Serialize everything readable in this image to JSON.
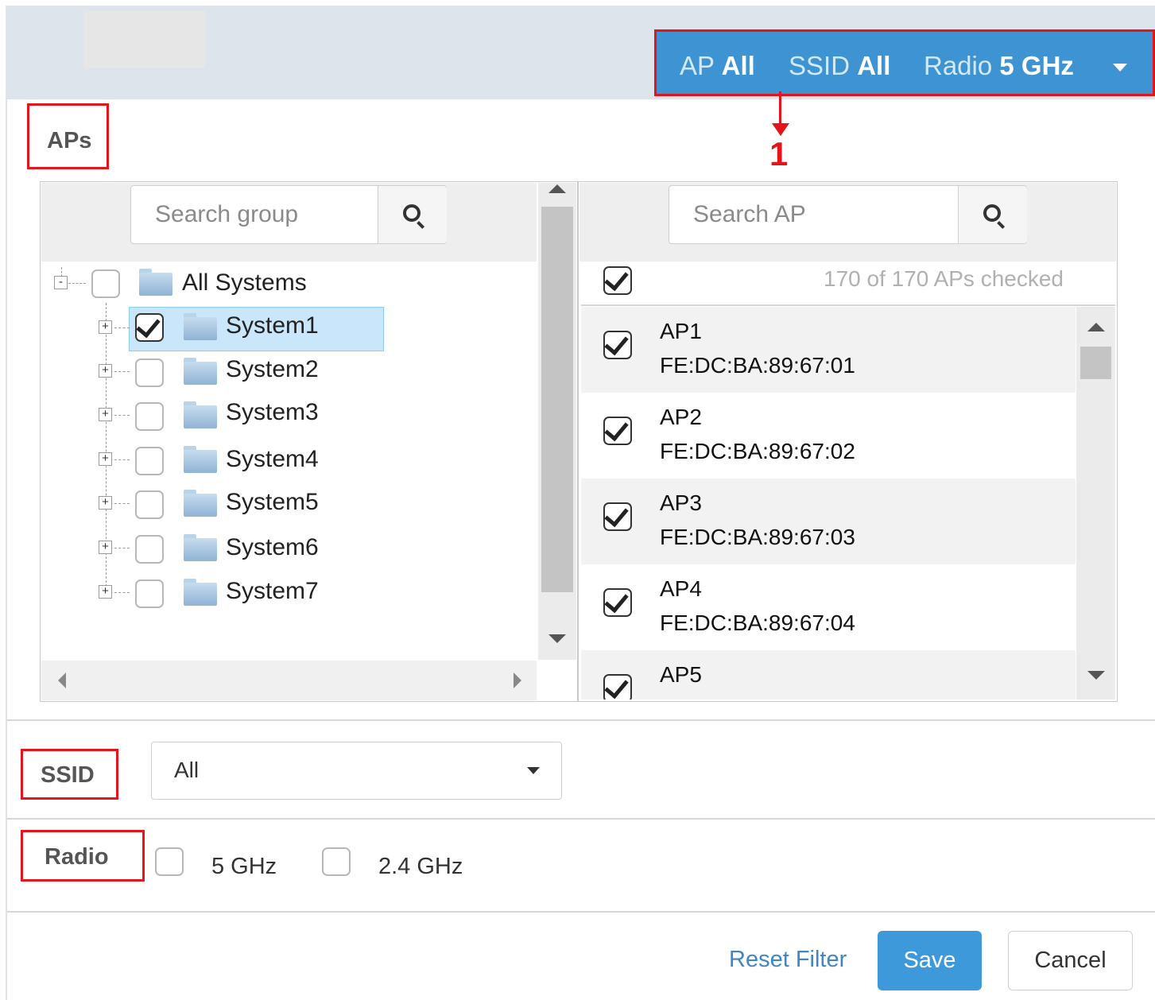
{
  "header": {
    "filter": {
      "ap_label": "AP",
      "ap_value": "All",
      "ssid_label": "SSID",
      "ssid_value": "All",
      "radio_label": "Radio",
      "radio_value": "5 GHz"
    },
    "callout_number": "1"
  },
  "aps_section": {
    "label": "APs",
    "group_search": {
      "placeholder": "Search group",
      "value": ""
    },
    "tree": {
      "root": {
        "label": "All Systems",
        "checked": false,
        "expanded": true
      },
      "children": [
        {
          "label": "System1",
          "checked": true,
          "selected": true
        },
        {
          "label": "System2",
          "checked": false
        },
        {
          "label": "System3",
          "checked": false
        },
        {
          "label": "System4",
          "checked": false
        },
        {
          "label": "System5",
          "checked": false
        },
        {
          "label": "System6",
          "checked": false
        },
        {
          "label": "System7",
          "checked": false
        }
      ]
    },
    "ap_search": {
      "placeholder": "Search AP",
      "value": ""
    },
    "select_all_checked": true,
    "checked_summary": "170 of 170 APs checked",
    "ap_list": [
      {
        "name": "AP1",
        "mac": "FE:DC:BA:89:67:01",
        "checked": true
      },
      {
        "name": "AP2",
        "mac": "FE:DC:BA:89:67:02",
        "checked": true
      },
      {
        "name": "AP3",
        "mac": "FE:DC:BA:89:67:03",
        "checked": true
      },
      {
        "name": "AP4",
        "mac": "FE:DC:BA:89:67:04",
        "checked": true
      },
      {
        "name": "AP5",
        "mac": "",
        "checked": true
      }
    ]
  },
  "ssid_section": {
    "label": "SSID",
    "selected": "All"
  },
  "radio_section": {
    "label": "Radio",
    "options": [
      {
        "label": "5 GHz",
        "checked": false
      },
      {
        "label": "2.4 GHz",
        "checked": false
      }
    ]
  },
  "footer": {
    "reset_label": "Reset Filter",
    "save_label": "Save",
    "cancel_label": "Cancel"
  },
  "colors": {
    "accent": "#3e93d2",
    "highlight_border": "#e3141b",
    "selection": "#c9e6fb",
    "link": "#3f86c6"
  }
}
